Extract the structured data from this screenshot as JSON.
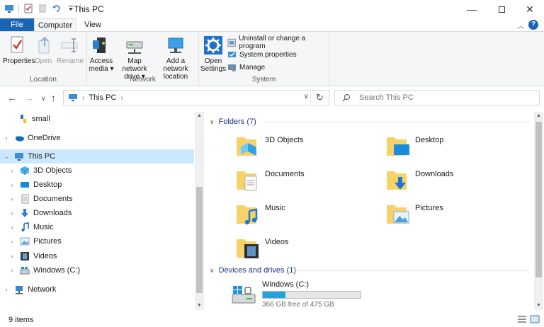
{
  "window": {
    "title": "This PC"
  },
  "ribbon_tabs": {
    "file": "File",
    "computer": "Computer",
    "view": "View"
  },
  "ribbon": {
    "location": {
      "label": "Location",
      "properties": "Properties",
      "open": "Open",
      "rename": "Rename"
    },
    "network": {
      "label": "Network",
      "access_media_1": "Access",
      "access_media_2": "media",
      "map_drive_1": "Map network",
      "map_drive_2": "drive",
      "add_location_1": "Add a network",
      "add_location_2": "location"
    },
    "system": {
      "label": "System",
      "open_settings_1": "Open",
      "open_settings_2": "Settings",
      "uninstall": "Uninstall or change a program",
      "system_properties": "System properties",
      "manage": "Manage"
    }
  },
  "address": {
    "crumb": "This PC",
    "search_placeholder": "Search This PC"
  },
  "navpane": {
    "items": [
      {
        "label": "small",
        "icon": "python-file-icon"
      },
      {
        "label": "OneDrive",
        "icon": "onedrive-icon"
      },
      {
        "label": "This PC",
        "icon": "computer-icon"
      },
      {
        "label": "3D Objects",
        "icon": "3d-objects-icon"
      },
      {
        "label": "Desktop",
        "icon": "desktop-icon"
      },
      {
        "label": "Documents",
        "icon": "documents-icon"
      },
      {
        "label": "Downloads",
        "icon": "downloads-icon"
      },
      {
        "label": "Music",
        "icon": "music-icon"
      },
      {
        "label": "Pictures",
        "icon": "pictures-icon"
      },
      {
        "label": "Videos",
        "icon": "videos-icon"
      },
      {
        "label": "Windows (C:)",
        "icon": "drive-icon"
      },
      {
        "label": "Network",
        "icon": "network-icon"
      }
    ]
  },
  "content": {
    "folders_header": "Folders (7)",
    "folders": [
      {
        "label": "3D Objects"
      },
      {
        "label": "Desktop"
      },
      {
        "label": "Documents"
      },
      {
        "label": "Downloads"
      },
      {
        "label": "Music"
      },
      {
        "label": "Pictures"
      },
      {
        "label": "Videos"
      }
    ],
    "devices_header": "Devices and drives (1)",
    "drive": {
      "name": "Windows (C:)",
      "free_text": "366 GB free of 475 GB",
      "used_fraction": 0.23
    }
  },
  "status": {
    "count": "9 items"
  },
  "colors": {
    "accent": "#1a64b4",
    "selection": "#cce8ff",
    "drive_bar": "#26a0da"
  }
}
